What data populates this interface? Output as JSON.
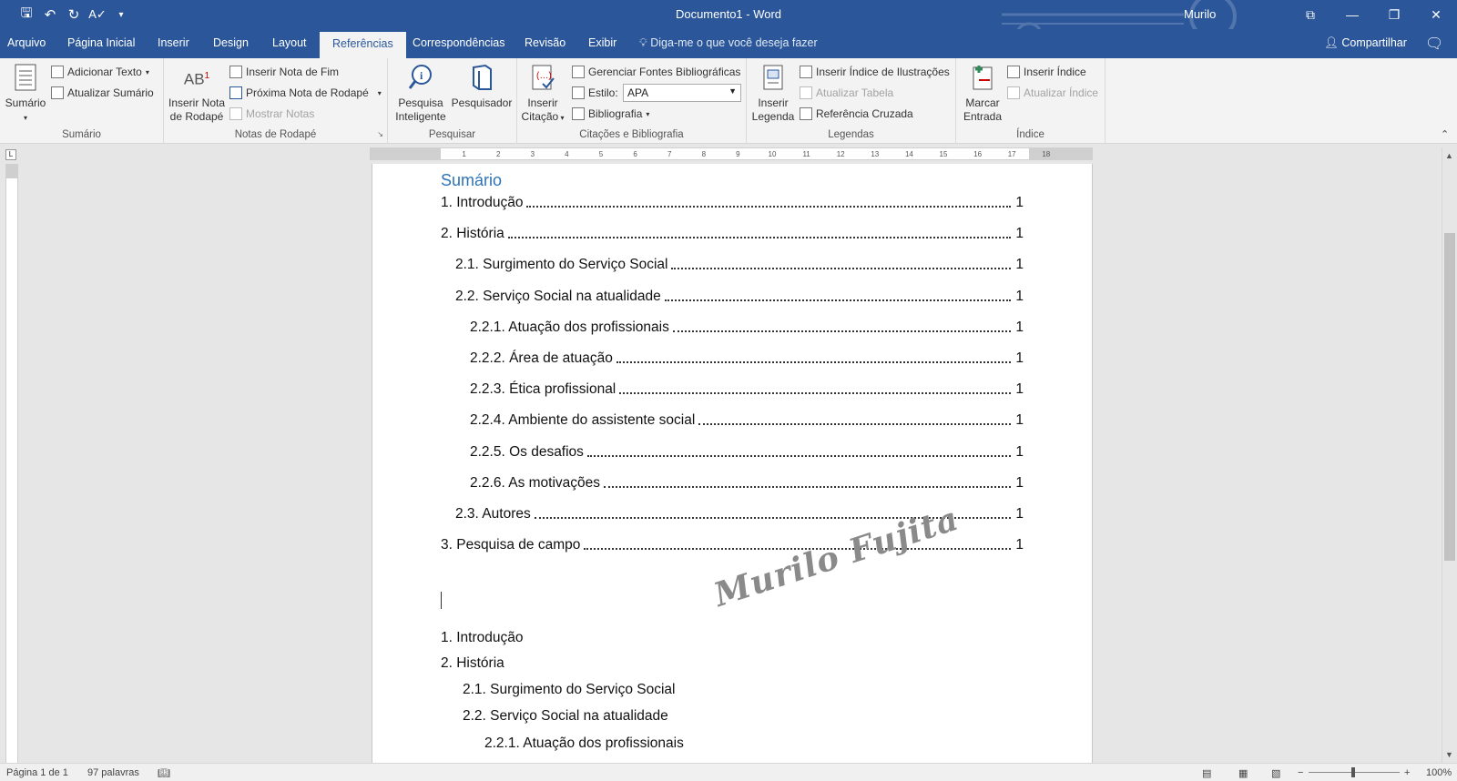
{
  "window": {
    "title": "Documento1  -  Word",
    "user": "Murilo",
    "colors": {
      "accent": "#2b579a",
      "heading": "#2e74b5"
    }
  },
  "tabs": [
    "Arquivo",
    "Página Inicial",
    "Inserir",
    "Design",
    "Layout",
    "Referências",
    "Correspondências",
    "Revisão",
    "Exibir"
  ],
  "active_tab": "Referências",
  "tellme": "Diga-me o que você deseja fazer",
  "share": "Compartilhar",
  "ribbon": {
    "sumario": {
      "big": "Sumário",
      "add_text": "Adicionar Texto",
      "update": "Atualizar Sumário",
      "label": "Sumário"
    },
    "notas": {
      "big_line1": "Inserir Nota",
      "big_line2": "de Rodapé",
      "insert_end": "Inserir Nota de Fim",
      "next": "Próxima Nota de Rodapé",
      "show": "Mostrar Notas",
      "label": "Notas de Rodapé"
    },
    "pesquisar": {
      "smart_line1": "Pesquisa",
      "smart_line2": "Inteligente",
      "researcher": "Pesquisador",
      "label": "Pesquisar"
    },
    "citacoes": {
      "insert_line1": "Inserir",
      "insert_line2": "Citação",
      "manage": "Gerenciar Fontes Bibliográficas",
      "style_label": "Estilo:",
      "style_value": "APA",
      "bibliography": "Bibliografia",
      "label": "Citações e Bibliografia"
    },
    "legendas": {
      "insert_line1": "Inserir",
      "insert_line2": "Legenda",
      "insert_index": "Inserir Índice de Ilustrações",
      "update_table": "Atualizar Tabela",
      "cross_ref": "Referência Cruzada",
      "label": "Legendas"
    },
    "indice": {
      "mark_line1": "Marcar",
      "mark_line2": "Entrada",
      "insert": "Inserir Índice",
      "update": "Atualizar Índice",
      "label": "Índice"
    }
  },
  "document": {
    "toc_title": "Sumário",
    "toc": [
      {
        "text": "1. Introdução",
        "page": "1",
        "level": 0
      },
      {
        "text": "2. História",
        "page": "1",
        "level": 0
      },
      {
        "text": "2.1. Surgimento do Serviço Social",
        "page": "1",
        "level": 1
      },
      {
        "text": "2.2. Serviço Social na atualidade",
        "page": "1",
        "level": 1
      },
      {
        "text": "2.2.1. Atuação dos profissionais",
        "page": "1",
        "level": 2
      },
      {
        "text": "2.2.2. Área de atuação",
        "page": "1",
        "level": 2
      },
      {
        "text": "2.2.3. Ética profissional",
        "page": "1",
        "level": 2
      },
      {
        "text": "2.2.4. Ambiente do assistente social",
        "page": "1",
        "level": 2
      },
      {
        "text": "2.2.5. Os desafios",
        "page": "1",
        "level": 2
      },
      {
        "text": "2.2.6. As motivações",
        "page": "1",
        "level": 2
      },
      {
        "text": "2.3. Autores",
        "page": "1",
        "level": 1
      },
      {
        "text": "3. Pesquisa de campo",
        "page": "1",
        "level": 0
      }
    ],
    "watermark": "Murilo Fujita",
    "body": [
      "1. Introdução",
      "2. História",
      "2.1. Surgimento do Serviço Social",
      "2.2. Serviço Social na atualidade",
      "2.2.1. Atuação dos profissionais"
    ]
  },
  "status": {
    "page": "Página 1 de 1",
    "words": "97 palavras",
    "zoom": "100%"
  }
}
